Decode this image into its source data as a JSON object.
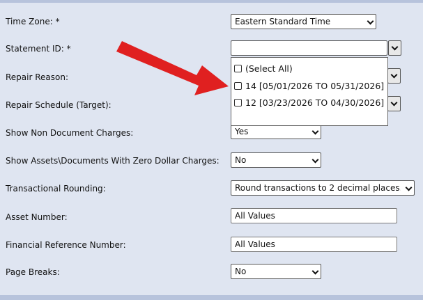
{
  "form": {
    "fields": [
      {
        "label": "Time Zone: *",
        "value": "Eastern Standard Time"
      },
      {
        "label": "Statement ID: *",
        "value": ""
      },
      {
        "label": "Repair Reason:",
        "value": ""
      },
      {
        "label": "Repair Schedule (Target):",
        "value": ""
      },
      {
        "label": "Show Non Document Charges:",
        "value": "Yes"
      },
      {
        "label": "Show Assets\\Documents With Zero Dollar Charges:",
        "value": "No"
      },
      {
        "label": "Transactional Rounding:",
        "value": "Round transactions to 2 decimal places."
      },
      {
        "label": "Asset Number:",
        "value": "All Values"
      },
      {
        "label": "Financial Reference Number:",
        "value": "All Values"
      },
      {
        "label": "Page Breaks:",
        "value": "No"
      }
    ]
  },
  "statement_dropdown": {
    "options": [
      {
        "label": "(Select All)",
        "checked": false
      },
      {
        "label": "14  [05/01/2026 TO 05/31/2026]",
        "checked": false
      },
      {
        "label": "12  [03/23/2026 TO 04/30/2026]",
        "checked": false
      }
    ]
  },
  "colors": {
    "background": "#dfe5f1",
    "arrow": "#e02020"
  },
  "icons": {
    "dropdown": "chevron-down-icon",
    "annotation": "red-arrow-icon"
  }
}
